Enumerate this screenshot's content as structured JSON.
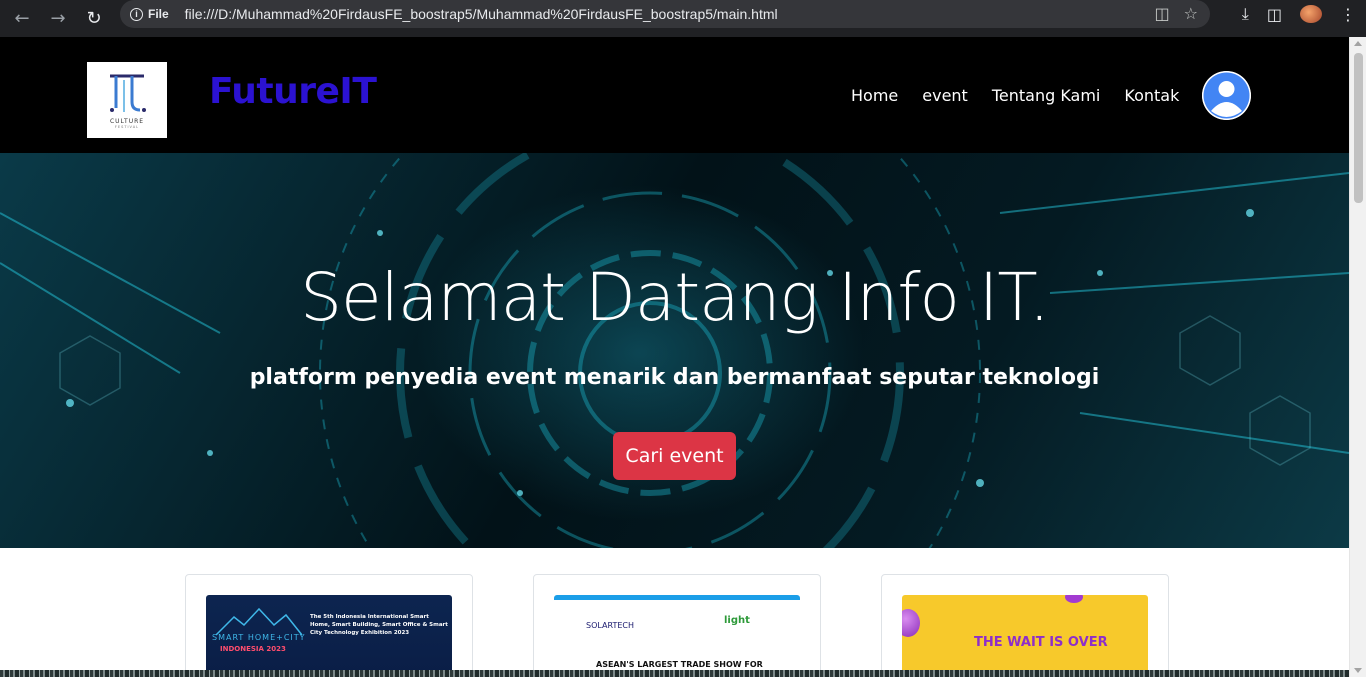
{
  "browser": {
    "back_icon": "arrow-left-icon",
    "forward_icon": "arrow-right-icon",
    "reload_icon": "reload-icon",
    "file_label": "File",
    "url": "file:///D:/Muhammad%20FirdausFE_boostrap5/Muhammad%20FirdausFE_boostrap5/main.html"
  },
  "site": {
    "logo": {
      "word": "CULTURE",
      "sub": "FESTIVAL"
    },
    "brand": "FutureIT",
    "brand_color": "#2b12d1",
    "menu": [
      {
        "label": "Home"
      },
      {
        "label": "event"
      },
      {
        "label": "Tentang Kami"
      },
      {
        "label": "Kontak"
      }
    ]
  },
  "hero": {
    "title": "Selamat Datang Info IT.",
    "subtitle": "platform penyedia event menarik dan bermanfaat seputar teknologi",
    "button": "Cari event",
    "button_color": "#dc3545"
  },
  "cards": [
    {
      "image_text": {
        "city": "SMART HOME+CITY",
        "edition": "INDONESIA 2023",
        "headline": "The 5th Indonesia International Smart Home, Smart Building, Smart Office & Smart City Technology Exhibition 2023"
      }
    },
    {
      "image_text": {
        "brand1": "SOLARTECH",
        "brand2": "light",
        "tagline": "ASEAN'S LARGEST TRADE SHOW FOR"
      }
    },
    {
      "image_text": {
        "headline": "THE WAIT IS OVER"
      }
    }
  ]
}
